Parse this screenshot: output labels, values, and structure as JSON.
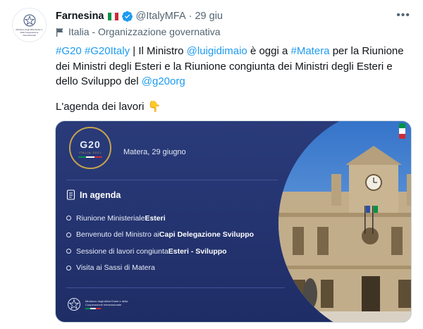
{
  "account": {
    "name": "Farnesina",
    "handle": "@ItalyMFA",
    "separator": "·",
    "time": "29 giu",
    "avatar_text": "Ministero degli Affari Esteri e della Cooperazione Internazionale",
    "label": "Italia - Organizzazione governativa"
  },
  "tweet": {
    "hashtag1": "#G20",
    "hashtag2": "#G20Italy",
    "text1": " | Il Ministro ",
    "mention1": "@luigidimaio",
    "text2": " è oggi a ",
    "hashtag3": "#Matera",
    "text3": " per la Riunione dei Ministri degli Esteri e la Riunione congiunta dei Ministri degli Esteri e dello Sviluppo del ",
    "mention2": "@g20org",
    "agenda_line": "L'agenda dei lavori",
    "emoji": "👇"
  },
  "card": {
    "logo_text": "G20",
    "logo_sub": "ITALIA 2021",
    "date": "Matera, 29 giugno",
    "agenda_title": "In agenda",
    "items": [
      {
        "pre": "Riunione Ministeriale ",
        "bold": "Esteri"
      },
      {
        "pre": "Benvenuto del Ministro ai ",
        "bold": "Capi Delegazione Sviluppo"
      },
      {
        "pre": "Sessione di lavori congiunta ",
        "bold": "Esteri - Sviluppo"
      },
      {
        "pre": "Visita ai Sassi di Matera",
        "bold": ""
      }
    ],
    "footer_ministry": "Ministero degli Affari Esteri e della Cooperazione Internazionale"
  },
  "colors": {
    "accent": "#1d9bf0",
    "card_bg": "#24346f",
    "gold": "#c6a24d",
    "flag_green": "#009246",
    "flag_white": "#ffffff",
    "flag_red": "#ce2b37"
  },
  "icons": {
    "verified": "verified-badge-icon",
    "label": "flag-icon",
    "more": "more-icon",
    "agenda": "agenda-icon"
  }
}
